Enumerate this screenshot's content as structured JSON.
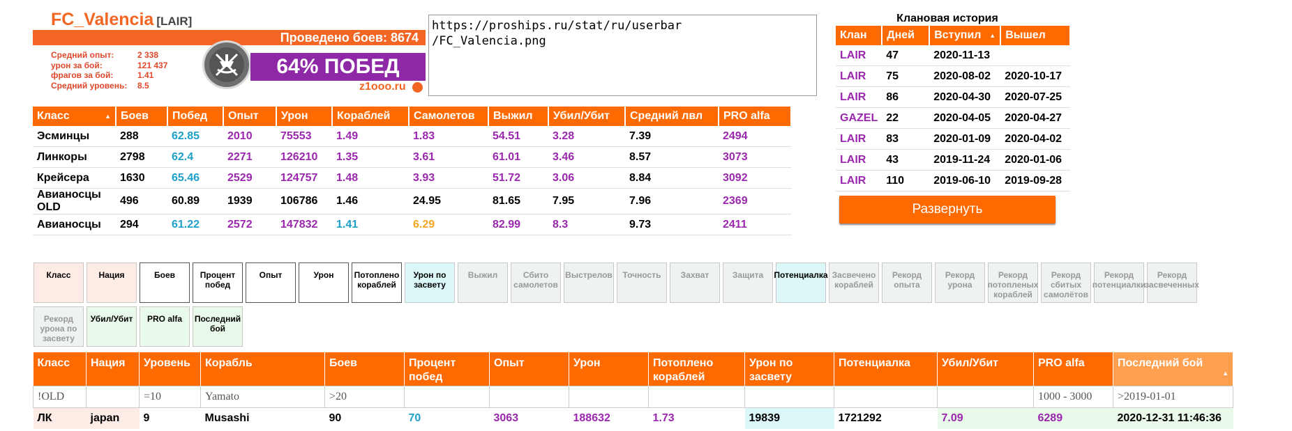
{
  "player": {
    "name": "FC_Valencia",
    "clan_tag": "[LAIR]",
    "battles_text": "Проведено боев: 8674",
    "mini_stats": [
      {
        "label": "Средний опыт:",
        "value": "2 338"
      },
      {
        "label": "урон за бой:",
        "value": "121 437"
      },
      {
        "label": "фрагов за бой:",
        "value": "1.41"
      },
      {
        "label": "Средний уровень:",
        "value": "8.5"
      }
    ],
    "win_text": "64% ПОБЕД",
    "site": "z1ooo.ru"
  },
  "userbar_url": "https://proships.ru/stat/ru/userbar\n/FC_Valencia.png",
  "class_table": {
    "headers": [
      "Класс",
      "Боев",
      "Побед",
      "Опыт",
      "Урон",
      "Кораблей",
      "Самолетов",
      "Выжил",
      "Убил/Убит",
      "Средний лвл",
      "PRO alfa"
    ],
    "rows": [
      {
        "cells": [
          "Эсминцы",
          "288",
          "62.85",
          "2010",
          "75553",
          "1.49",
          "1.83",
          "54.51",
          "3.28",
          "7.39",
          "2494"
        ],
        "colors": [
          "blk",
          "blk",
          "cyan",
          "pur",
          "pur",
          "pur",
          "pur",
          "pur",
          "pur",
          "blk",
          "pur"
        ]
      },
      {
        "cells": [
          "Линкоры",
          "2798",
          "62.4",
          "2271",
          "126210",
          "1.35",
          "3.61",
          "61.01",
          "3.46",
          "8.57",
          "3073"
        ],
        "colors": [
          "blk",
          "blk",
          "cyan",
          "pur",
          "pur",
          "pur",
          "pur",
          "pur",
          "pur",
          "blk",
          "pur"
        ]
      },
      {
        "cells": [
          "Крейсера",
          "1630",
          "65.46",
          "2529",
          "124757",
          "1.48",
          "3.93",
          "51.72",
          "3.06",
          "8.84",
          "3092"
        ],
        "colors": [
          "blk",
          "blk",
          "cyan",
          "pur",
          "pur",
          "pur",
          "pur",
          "pur",
          "pur",
          "blk",
          "pur"
        ]
      },
      {
        "cells": [
          "Авианосцы OLD",
          "496",
          "60.89",
          "1939",
          "106786",
          "1.46",
          "24.95",
          "81.65",
          "7.95",
          "7.96",
          "2369"
        ],
        "colors": [
          "blk",
          "blk",
          "blk",
          "blk",
          "blk",
          "blk",
          "blk",
          "blk",
          "blk",
          "blk",
          "pur"
        ]
      },
      {
        "cells": [
          "Авианосцы",
          "294",
          "61.22",
          "2572",
          "147832",
          "1.41",
          "6.29",
          "82.99",
          "8.3",
          "9.73",
          "2411"
        ],
        "colors": [
          "blk",
          "blk",
          "cyan",
          "pur",
          "pur",
          "cyan",
          "yel",
          "pur",
          "pur",
          "blk",
          "pur"
        ]
      }
    ]
  },
  "clan_history": {
    "title": "Клановая история",
    "headers": [
      "Клан",
      "Дней",
      "Вступил",
      "Вышел"
    ],
    "rows": [
      [
        "LAIR",
        "47",
        "2020-11-13",
        ""
      ],
      [
        "LAIR",
        "75",
        "2020-08-02",
        "2020-10-17"
      ],
      [
        "LAIR",
        "86",
        "2020-04-30",
        "2020-07-25"
      ],
      [
        "GAZEL",
        "22",
        "2020-04-05",
        "2020-04-27"
      ],
      [
        "LAIR",
        "83",
        "2020-01-09",
        "2020-04-02"
      ],
      [
        "LAIR",
        "43",
        "2019-11-24",
        "2020-01-06"
      ],
      [
        "LAIR",
        "110",
        "2019-06-10",
        "2019-09-28"
      ]
    ],
    "expand_label": "Развернуть"
  },
  "filter_buttons": [
    {
      "label": "Класс",
      "style": "peach"
    },
    {
      "label": "Нация",
      "style": "peach"
    },
    {
      "label": "Боев",
      "style": "white"
    },
    {
      "label": "Процент побед",
      "style": "white"
    },
    {
      "label": "Опыт",
      "style": "white"
    },
    {
      "label": "Урон",
      "style": "white"
    },
    {
      "label": "Потоплено кораблей",
      "style": "white"
    },
    {
      "label": "Урон по засвету",
      "style": "cyan"
    },
    {
      "label": "Выжил",
      "style": "grey"
    },
    {
      "label": "Сбито самолетов",
      "style": "grey"
    },
    {
      "label": "Выстрелов",
      "style": "grey"
    },
    {
      "label": "Точность",
      "style": "grey"
    },
    {
      "label": "Захват",
      "style": "grey"
    },
    {
      "label": "Защита",
      "style": "grey"
    },
    {
      "label": "Потенциалка",
      "style": "cyan"
    },
    {
      "label": "Засвечено кораблей",
      "style": "grey"
    },
    {
      "label": "Рекорд опыта",
      "style": "grey"
    },
    {
      "label": "Рекорд урона",
      "style": "grey"
    },
    {
      "label": "Рекорд потопленых кораблей",
      "style": "grey"
    },
    {
      "label": "Рекорд сбитых самолётов",
      "style": "grey"
    },
    {
      "label": "Рекорд потенциалки",
      "style": "grey"
    },
    {
      "label": "Рекорд засвеченных",
      "style": "grey"
    },
    {
      "label": "Рекорд урона по засвету",
      "style": "grey"
    },
    {
      "label": "Убил/Убит",
      "style": "green"
    },
    {
      "label": "PRO alfa",
      "style": "green"
    },
    {
      "label": "Последний бой",
      "style": "green"
    }
  ],
  "ship_table": {
    "headers": [
      "Класс",
      "Нация",
      "Уровень",
      "Корабль",
      "Боев",
      "Процент побед",
      "Опыт",
      "Урон",
      "Потоплено кораблей",
      "Урон по засвету",
      "Потенциалка",
      "Убил/Убит",
      "PRO alfa",
      "Последний бой"
    ],
    "filters": [
      "!OLD",
      "",
      "=10",
      "Yamato",
      ">20",
      "",
      "",
      "",
      "",
      "",
      "",
      "",
      "1000 - 3000",
      ">2019-01-01"
    ],
    "row": {
      "cells": [
        "ЛК",
        "japan",
        "9",
        "Musashi",
        "90",
        "70",
        "3063",
        "188632",
        "1.73",
        "19839",
        "1721292",
        "7.09",
        "6289",
        "2020-12-31 11:46:36"
      ],
      "colors": [
        "#000",
        "#000",
        "#000",
        "#000",
        "#000",
        "#1ea0c8",
        "#9a27ad",
        "#9a27ad",
        "#9a27ad",
        "#000",
        "#000",
        "#9a27ad",
        "#9a27ad",
        "#000"
      ]
    }
  },
  "colors": {
    "accent": "#ff6a00",
    "purple": "#9a27ad",
    "cyan": "#1ea0c8"
  }
}
